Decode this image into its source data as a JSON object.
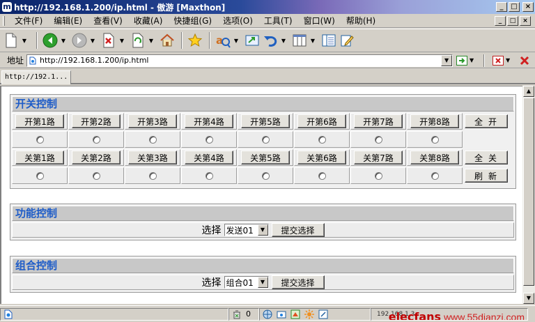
{
  "window": {
    "title": "http://192.168.1.200/ip.html - 傲游 [Maxthon]",
    "app_icon_glyph": "m",
    "minimize": "_",
    "maximize": "□",
    "close": "×"
  },
  "menu": {
    "items": [
      "文件(F)",
      "编辑(E)",
      "查看(V)",
      "收藏(A)",
      "快捷组(G)",
      "选项(O)",
      "工具(T)",
      "窗口(W)",
      "帮助(H)"
    ]
  },
  "toolbar": {
    "icons": [
      "new-page-icon",
      "back-icon",
      "forward-icon",
      "stop-icon",
      "refresh-icon",
      "home-icon",
      "favorites-star-icon",
      "search-engine-icon",
      "fullscreen-icon",
      "undo-close-icon",
      "column-view-icon",
      "sidebar-icon",
      "edit-icon"
    ]
  },
  "address": {
    "label": "地址",
    "url": "http://192.168.1.200/ip.html"
  },
  "tabs": [
    {
      "label": "http://192.1..."
    }
  ],
  "switch_panel": {
    "title": "开关控制",
    "on_buttons": [
      "开第1路",
      "开第2路",
      "开第3路",
      "开第4路",
      "开第5路",
      "开第6路",
      "开第7路",
      "开第8路"
    ],
    "all_on": "全开",
    "off_buttons": [
      "关第1路",
      "关第2路",
      "关第3路",
      "关第4路",
      "关第5路",
      "关第6路",
      "关第7路",
      "关第8路"
    ],
    "all_off": "全关",
    "refresh": "刷新"
  },
  "function_panel": {
    "title": "功能控制",
    "label": "选择",
    "selected": "发送01",
    "submit": "提交选择"
  },
  "group_panel": {
    "title": "组合控制",
    "label": "选择",
    "selected": "组合01",
    "submit": "提交选择"
  },
  "status": {
    "count": "0",
    "address": "192.168.1.3",
    "watermark_left": "elecfans",
    "watermark_right": "www.55dianzi.com"
  },
  "colors": {
    "panel_title": "#1e5cc8",
    "panel_header_bg": "#c8c8c8",
    "title_bar_start": "#0a246a",
    "title_bar_end": "#a6caf0"
  }
}
